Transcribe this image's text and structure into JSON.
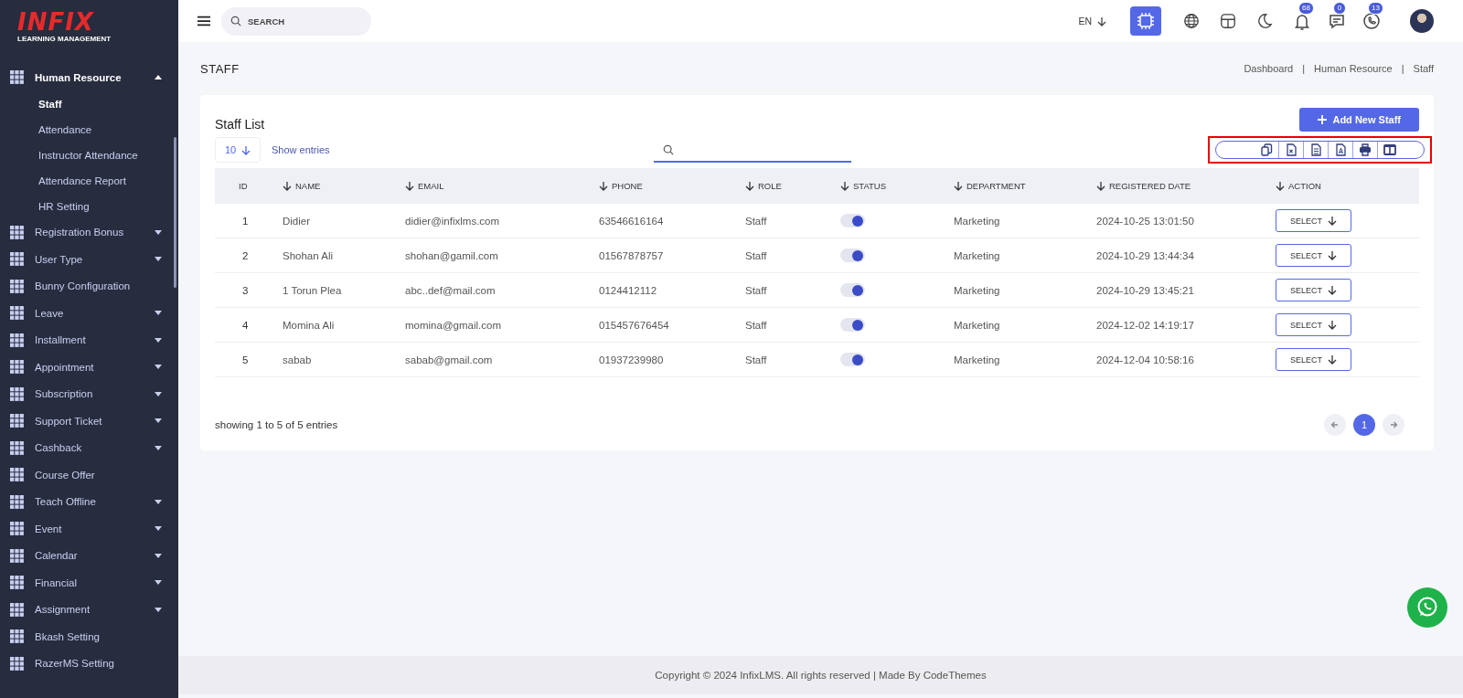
{
  "sidebar": {
    "logo": "INFIX",
    "logo_subtitle": "LEARNING MANAGEMENT",
    "items": [
      {
        "label": "Human Resource",
        "kind": "group",
        "expanded": true,
        "children": [
          {
            "label": "Staff",
            "selected": true
          },
          {
            "label": "Attendance",
            "selected": false
          },
          {
            "label": "Instructor Attendance",
            "selected": false
          },
          {
            "label": "Attendance Report",
            "selected": false
          },
          {
            "label": "HR Setting",
            "selected": false
          }
        ]
      },
      {
        "label": "Registration Bonus",
        "kind": "group",
        "expanded": false
      },
      {
        "label": "User Type",
        "kind": "group",
        "expanded": false
      },
      {
        "label": "Bunny Configuration",
        "kind": "link"
      },
      {
        "label": "Leave",
        "kind": "group",
        "expanded": false
      },
      {
        "label": "Installment",
        "kind": "group",
        "expanded": false
      },
      {
        "label": "Appointment",
        "kind": "group",
        "expanded": false
      },
      {
        "label": "Subscription",
        "kind": "group",
        "expanded": false
      },
      {
        "label": "Support Ticket",
        "kind": "group",
        "expanded": false
      },
      {
        "label": "Cashback",
        "kind": "group",
        "expanded": false
      },
      {
        "label": "Course Offer",
        "kind": "link"
      },
      {
        "label": "Teach Offline",
        "kind": "group",
        "expanded": false
      },
      {
        "label": "Event",
        "kind": "group",
        "expanded": false
      },
      {
        "label": "Calendar",
        "kind": "group",
        "expanded": false
      },
      {
        "label": "Financial",
        "kind": "group",
        "expanded": false
      },
      {
        "label": "Assignment",
        "kind": "group",
        "expanded": false
      },
      {
        "label": "Bkash Setting",
        "kind": "link"
      },
      {
        "label": "RazerMS Setting",
        "kind": "link"
      }
    ]
  },
  "header": {
    "search": {
      "placeholder": "SEARCH"
    },
    "language": "EN",
    "badges": [
      {
        "kind": "bell",
        "count": "68"
      },
      {
        "kind": "chat",
        "count": "0"
      },
      {
        "kind": "phone",
        "count": "13"
      }
    ]
  },
  "page": {
    "title": "STAFF",
    "breadcrumbs": [
      "Dashboard",
      "Human Resource",
      "Staff"
    ],
    "breadcrumb_separator": "|"
  },
  "card": {
    "title": "Staff List",
    "add_button": "Add New Staff",
    "page_size": "10",
    "show_entries": "Show entries",
    "export_buttons": [
      {
        "kind": "copy"
      },
      {
        "kind": "excel"
      },
      {
        "kind": "csv"
      },
      {
        "kind": "pdf"
      },
      {
        "kind": "print"
      },
      {
        "kind": "columns"
      }
    ],
    "highlighted": true,
    "table": {
      "columns": [
        {
          "label": "ID",
          "sortable": false
        },
        {
          "label": "NAME",
          "sortable": true
        },
        {
          "label": "EMAIL",
          "sortable": true
        },
        {
          "label": "PHONE",
          "sortable": true
        },
        {
          "label": "ROLE",
          "sortable": true
        },
        {
          "label": "STATUS",
          "sortable": true
        },
        {
          "label": "DEPARTMENT",
          "sortable": true
        },
        {
          "label": "REGISTERED DATE",
          "sortable": true
        },
        {
          "label": "ACTION",
          "sortable": true
        }
      ],
      "rows": [
        {
          "id": "1",
          "name": "Didier",
          "email": "didier@infixlms.com",
          "phone": "63546616164",
          "role": "Staff",
          "status_on": true,
          "department": "Marketing",
          "registered": "2024-10-25 13:01:50",
          "action": "SELECT"
        },
        {
          "id": "2",
          "name": "Shohan Ali",
          "email": "shohan@gamil.com",
          "phone": "01567878757",
          "role": "Staff",
          "status_on": true,
          "department": "Marketing",
          "registered": "2024-10-29 13:44:34",
          "action": "SELECT"
        },
        {
          "id": "3",
          "name": "1 Torun Plea",
          "email": "abc..def@mail.com",
          "phone": "0124412112",
          "role": "Staff",
          "status_on": true,
          "department": "Marketing",
          "registered": "2024-10-29 13:45:21",
          "action": "SELECT"
        },
        {
          "id": "4",
          "name": "Momina Ali",
          "email": "momina@gmail.com",
          "phone": "015457676454",
          "role": "Staff",
          "status_on": true,
          "department": "Marketing",
          "registered": "2024-12-02 14:19:17",
          "action": "SELECT"
        },
        {
          "id": "5",
          "name": "sabab",
          "email": "sabab@gmail.com",
          "phone": "01937239980",
          "role": "Staff",
          "status_on": true,
          "department": "Marketing",
          "registered": "2024-12-04 10:58:16",
          "action": "SELECT"
        }
      ]
    },
    "summary": "showing 1 to 5 of 5 entries",
    "pages": [
      {
        "label": "1",
        "selected": true
      }
    ]
  },
  "footer": "Copyright © 2024 InfixLMS. All rights reserved | Made By CodeThemes"
}
